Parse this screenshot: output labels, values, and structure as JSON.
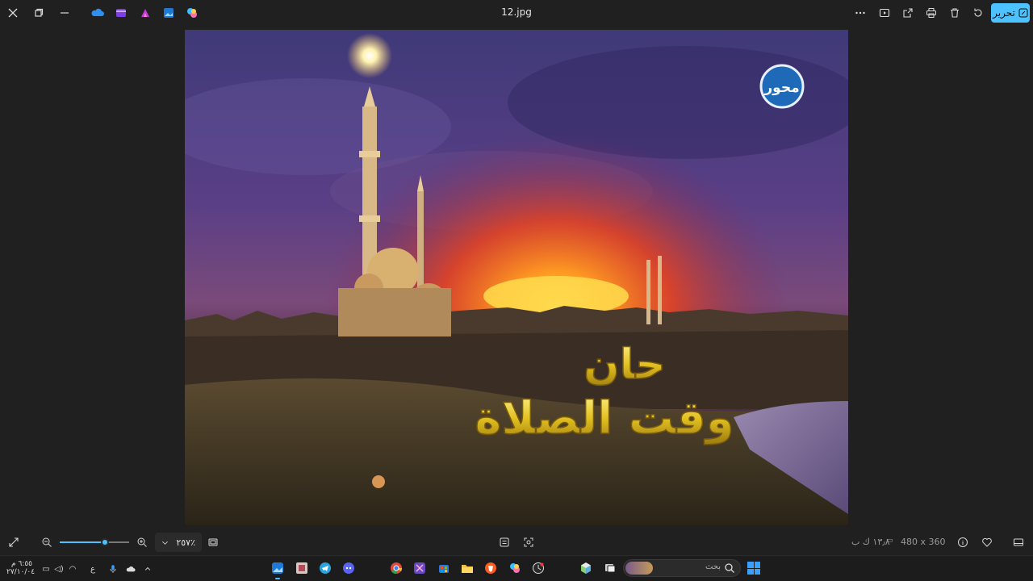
{
  "titlebar": {
    "filename": "12.jpg",
    "edit_label": "تحرير",
    "icons": [
      "close-icon",
      "restore-icon",
      "minimize-icon",
      "onedrive-icon",
      "clipchamp-icon",
      "designer-icon",
      "photos-icon",
      "copilot-icon",
      "more-icon",
      "slideshow-icon",
      "share-icon",
      "print-icon",
      "delete-icon",
      "rotate-icon",
      "edit-icon"
    ]
  },
  "photo": {
    "logo_text": "محور",
    "title_line1": "حان",
    "title_line2": "وقت الصلاة",
    "colors": {
      "sky_top": "#4a3d7a",
      "sunset": "#ff6a1a",
      "sun": "#ffd65a",
      "title_gold": "#f0d040"
    }
  },
  "bottombar": {
    "zoom_value": "٢٥٧٪",
    "zoom_level": 0.65,
    "dimensions": "480 x 360",
    "file_size": "١٣٫٨ ك ب",
    "icons": [
      "fullscreen-icon",
      "zoom-out-icon",
      "zoom-in-icon",
      "chevron-down-icon",
      "fit-icon",
      "filmstrip-icon",
      "image-recognize-icon",
      "info-icon",
      "favorite-icon",
      "layout-icon"
    ]
  },
  "taskbar": {
    "time": "٦:٥٥ م",
    "date": "٢٧/١٠/٠٤",
    "lang": "ع",
    "search_placeholder": "بحث",
    "accent": "#4cc2ff"
  }
}
